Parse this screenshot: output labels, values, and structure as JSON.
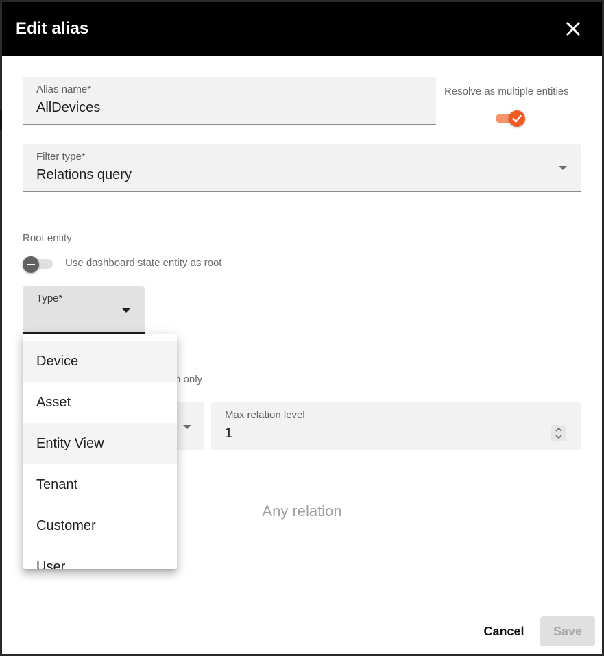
{
  "dialog": {
    "title": "Edit alias",
    "close_icon": "close-icon"
  },
  "alias_name": {
    "label": "Alias name*",
    "value": "AllDevices"
  },
  "resolve_multiple": {
    "label": "Resolve as multiple entities",
    "checked": true,
    "accent_color": "#f15a22"
  },
  "filter_type": {
    "label": "Filter type*",
    "value": "Relations query"
  },
  "root_entity": {
    "section_label": "Root entity",
    "use_dashboard_state_label": "Use dashboard state entity as root",
    "use_dashboard_state_checked": false
  },
  "type_field": {
    "label": "Type*",
    "value": ""
  },
  "type_dropdown": {
    "options": [
      "Device",
      "Asset",
      "Entity View",
      "Tenant",
      "Customer",
      "User"
    ]
  },
  "partially_hidden_text": "n only",
  "max_relation_level": {
    "label": "Max relation level",
    "value": "1"
  },
  "relation_filters": {
    "empty_text": "Any relation"
  },
  "actions": {
    "cancel_label": "Cancel",
    "save_label": "Save"
  }
}
